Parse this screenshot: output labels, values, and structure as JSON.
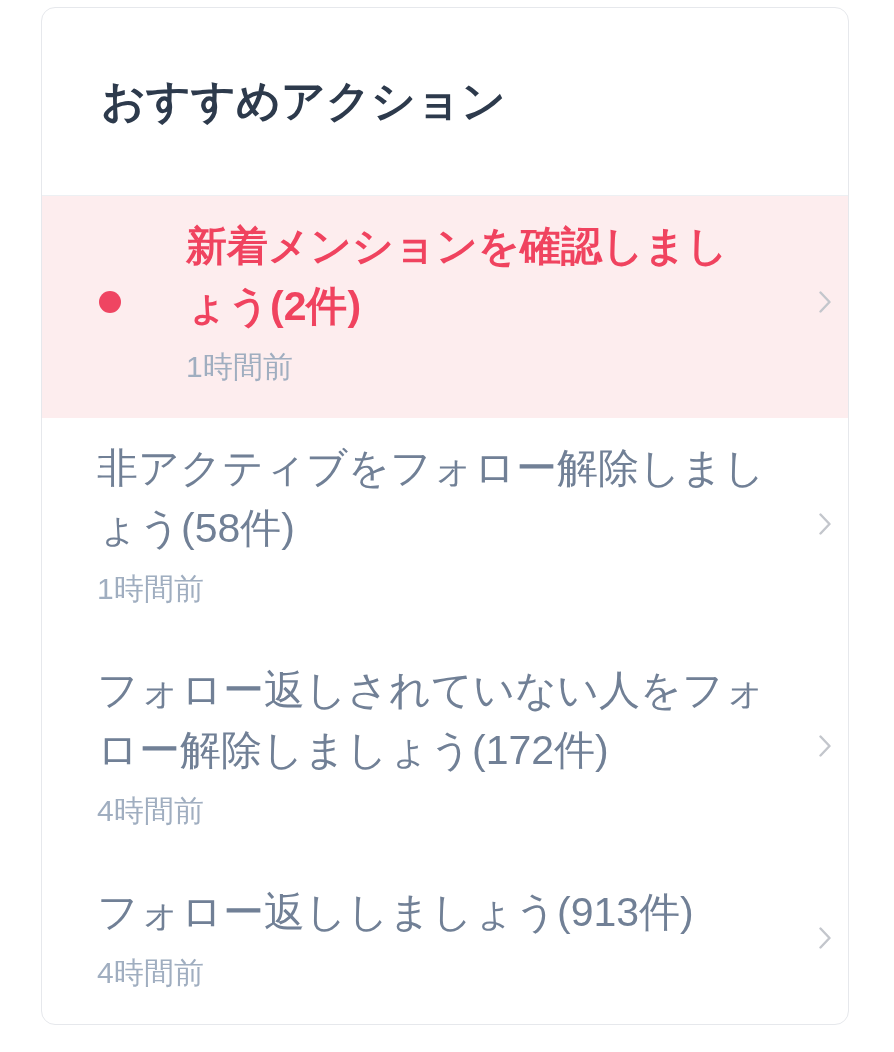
{
  "card": {
    "title": "おすすめアクション",
    "items": [
      {
        "title": "新着メンションを確認しましょう(2件)",
        "time": "1時間前",
        "unread": true
      },
      {
        "title": "非アクティブをフォロー解除しましょう(58件)",
        "time": "1時間前",
        "unread": false
      },
      {
        "title": "フォロー返しされていない人をフォロー解除しましょう(172件)",
        "time": "4時間前",
        "unread": false
      },
      {
        "title": "フォロー返ししましょう(913件)",
        "time": "4時間前",
        "unread": false
      }
    ]
  }
}
